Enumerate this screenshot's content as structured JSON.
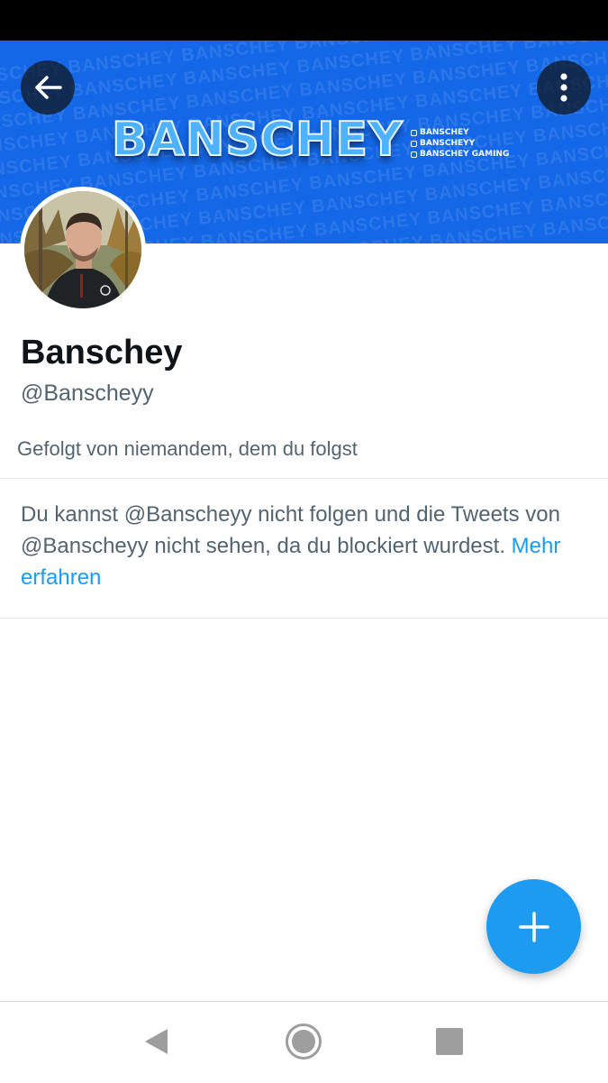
{
  "profile": {
    "display_name": "Banschey",
    "handle": "@Banscheyy",
    "followed_by": "Gefolgt von niemandem, dem du folgst"
  },
  "banner": {
    "logo_text": "BANSCHEY",
    "pattern_text": "BANSCHEY",
    "socials": [
      "BANSCHEY",
      "BANSCHEYY",
      "BANSCHEY GAMING"
    ],
    "color": "#1467e6"
  },
  "blocked": {
    "message": "Du kannst @Banscheyy nicht folgen und die Tweets von @Banscheyy nicht sehen, da du blockiert wurdest.",
    "link_label": "Mehr erfahren"
  },
  "icons": {
    "back": "arrow-left-icon",
    "more": "more-vertical-icon",
    "compose": "plus-icon",
    "nav_back": "triangle-back-icon",
    "nav_home": "circle-home-icon",
    "nav_recents": "square-recents-icon"
  },
  "colors": {
    "accent": "#1d9bf0",
    "text_primary": "#0f1419",
    "text_secondary": "#536471"
  }
}
